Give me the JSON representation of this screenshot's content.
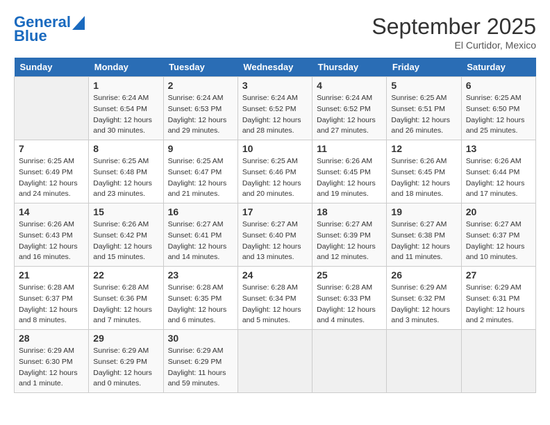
{
  "header": {
    "logo_line1": "General",
    "logo_line2": "Blue",
    "month": "September 2025",
    "location": "El Curtidor, Mexico"
  },
  "days_of_week": [
    "Sunday",
    "Monday",
    "Tuesday",
    "Wednesday",
    "Thursday",
    "Friday",
    "Saturday"
  ],
  "weeks": [
    [
      {
        "day": "",
        "empty": true
      },
      {
        "day": "1",
        "sunrise": "6:24 AM",
        "sunset": "6:54 PM",
        "daylight": "12 hours and 30 minutes."
      },
      {
        "day": "2",
        "sunrise": "6:24 AM",
        "sunset": "6:53 PM",
        "daylight": "12 hours and 29 minutes."
      },
      {
        "day": "3",
        "sunrise": "6:24 AM",
        "sunset": "6:52 PM",
        "daylight": "12 hours and 28 minutes."
      },
      {
        "day": "4",
        "sunrise": "6:24 AM",
        "sunset": "6:52 PM",
        "daylight": "12 hours and 27 minutes."
      },
      {
        "day": "5",
        "sunrise": "6:25 AM",
        "sunset": "6:51 PM",
        "daylight": "12 hours and 26 minutes."
      },
      {
        "day": "6",
        "sunrise": "6:25 AM",
        "sunset": "6:50 PM",
        "daylight": "12 hours and 25 minutes."
      }
    ],
    [
      {
        "day": "7",
        "sunrise": "6:25 AM",
        "sunset": "6:49 PM",
        "daylight": "12 hours and 24 minutes."
      },
      {
        "day": "8",
        "sunrise": "6:25 AM",
        "sunset": "6:48 PM",
        "daylight": "12 hours and 23 minutes."
      },
      {
        "day": "9",
        "sunrise": "6:25 AM",
        "sunset": "6:47 PM",
        "daylight": "12 hours and 21 minutes."
      },
      {
        "day": "10",
        "sunrise": "6:25 AM",
        "sunset": "6:46 PM",
        "daylight": "12 hours and 20 minutes."
      },
      {
        "day": "11",
        "sunrise": "6:26 AM",
        "sunset": "6:45 PM",
        "daylight": "12 hours and 19 minutes."
      },
      {
        "day": "12",
        "sunrise": "6:26 AM",
        "sunset": "6:45 PM",
        "daylight": "12 hours and 18 minutes."
      },
      {
        "day": "13",
        "sunrise": "6:26 AM",
        "sunset": "6:44 PM",
        "daylight": "12 hours and 17 minutes."
      }
    ],
    [
      {
        "day": "14",
        "sunrise": "6:26 AM",
        "sunset": "6:43 PM",
        "daylight": "12 hours and 16 minutes."
      },
      {
        "day": "15",
        "sunrise": "6:26 AM",
        "sunset": "6:42 PM",
        "daylight": "12 hours and 15 minutes."
      },
      {
        "day": "16",
        "sunrise": "6:27 AM",
        "sunset": "6:41 PM",
        "daylight": "12 hours and 14 minutes."
      },
      {
        "day": "17",
        "sunrise": "6:27 AM",
        "sunset": "6:40 PM",
        "daylight": "12 hours and 13 minutes."
      },
      {
        "day": "18",
        "sunrise": "6:27 AM",
        "sunset": "6:39 PM",
        "daylight": "12 hours and 12 minutes."
      },
      {
        "day": "19",
        "sunrise": "6:27 AM",
        "sunset": "6:38 PM",
        "daylight": "12 hours and 11 minutes."
      },
      {
        "day": "20",
        "sunrise": "6:27 AM",
        "sunset": "6:37 PM",
        "daylight": "12 hours and 10 minutes."
      }
    ],
    [
      {
        "day": "21",
        "sunrise": "6:28 AM",
        "sunset": "6:37 PM",
        "daylight": "12 hours and 8 minutes."
      },
      {
        "day": "22",
        "sunrise": "6:28 AM",
        "sunset": "6:36 PM",
        "daylight": "12 hours and 7 minutes."
      },
      {
        "day": "23",
        "sunrise": "6:28 AM",
        "sunset": "6:35 PM",
        "daylight": "12 hours and 6 minutes."
      },
      {
        "day": "24",
        "sunrise": "6:28 AM",
        "sunset": "6:34 PM",
        "daylight": "12 hours and 5 minutes."
      },
      {
        "day": "25",
        "sunrise": "6:28 AM",
        "sunset": "6:33 PM",
        "daylight": "12 hours and 4 minutes."
      },
      {
        "day": "26",
        "sunrise": "6:29 AM",
        "sunset": "6:32 PM",
        "daylight": "12 hours and 3 minutes."
      },
      {
        "day": "27",
        "sunrise": "6:29 AM",
        "sunset": "6:31 PM",
        "daylight": "12 hours and 2 minutes."
      }
    ],
    [
      {
        "day": "28",
        "sunrise": "6:29 AM",
        "sunset": "6:30 PM",
        "daylight": "12 hours and 1 minute."
      },
      {
        "day": "29",
        "sunrise": "6:29 AM",
        "sunset": "6:29 PM",
        "daylight": "12 hours and 0 minutes."
      },
      {
        "day": "30",
        "sunrise": "6:29 AM",
        "sunset": "6:29 PM",
        "daylight": "11 hours and 59 minutes."
      },
      {
        "day": "",
        "empty": true
      },
      {
        "day": "",
        "empty": true
      },
      {
        "day": "",
        "empty": true
      },
      {
        "day": "",
        "empty": true
      }
    ]
  ]
}
